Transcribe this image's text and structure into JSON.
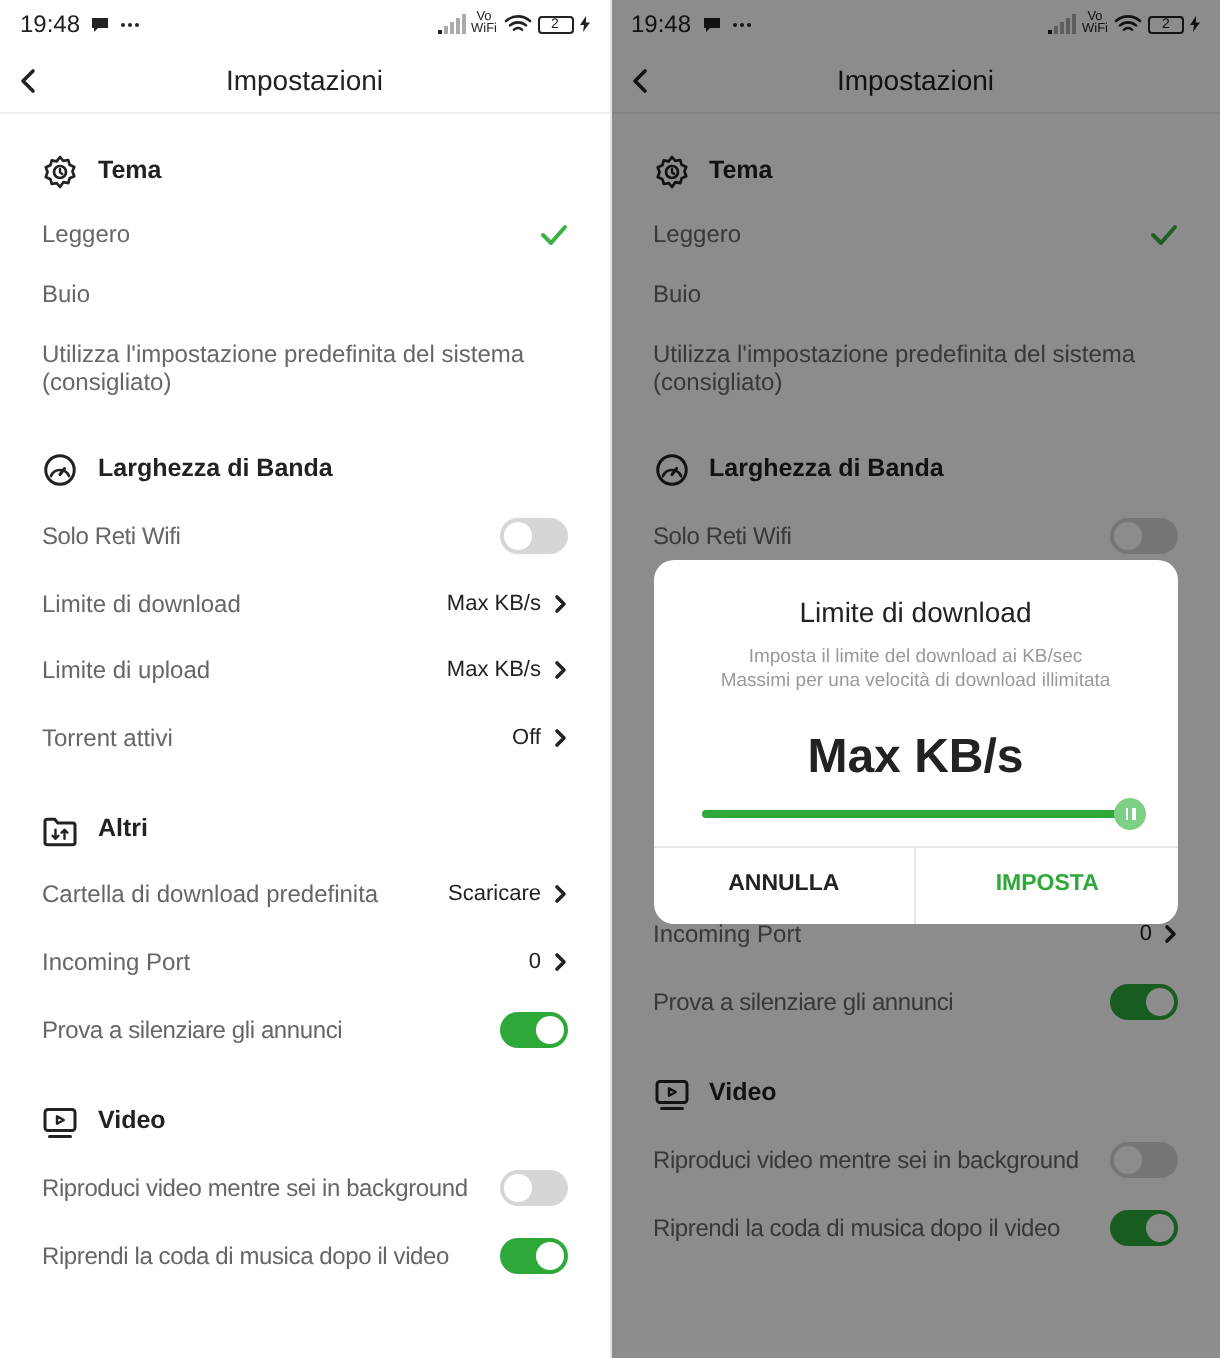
{
  "screens": [
    {
      "status_bar": {
        "time": "19:48",
        "network_top": "Vo",
        "network_bottom": "WiFi",
        "battery": "2"
      },
      "title": "Impostazioni",
      "items": [
        {
          "kind": "theme",
          "label": "Tema"
        },
        {
          "kind": "option",
          "label": "Leggero",
          "selected": true
        },
        {
          "kind": "option",
          "label": "Buio",
          "selected": false
        },
        {
          "kind": "option",
          "label": "Utilizza l'impostazione predefinita del sistema (consigliato)",
          "selected": false
        },
        {
          "kind": "bandwidth",
          "label": "Larghezza di Banda"
        },
        {
          "kind": "toggle",
          "label": "Solo Reti Wifi",
          "on": false
        },
        {
          "kind": "value",
          "label": "Limite di download",
          "value": "Max KB/s"
        },
        {
          "kind": "value",
          "label": "Limite di upload",
          "value": "Max KB/s"
        },
        {
          "kind": "value",
          "label": "Torrent attivi",
          "value": "Off"
        },
        {
          "kind": "others",
          "label": "Altri"
        },
        {
          "kind": "value",
          "label": "Cartella di download predefinita",
          "value": "Scaricare"
        },
        {
          "kind": "value",
          "label": "Incoming Port",
          "value": "0"
        },
        {
          "kind": "toggle",
          "label": "Prova a silenziare gli annunci",
          "on": true
        },
        {
          "kind": "video",
          "label": "Video"
        },
        {
          "kind": "toggle",
          "label": "Riproduci video mentre sei in background",
          "on": false
        },
        {
          "kind": "toggle",
          "label": "Riprendi la coda di musica dopo il video",
          "on": true
        }
      ]
    },
    {
      "status_bar": {
        "time": "19:48",
        "network_top": "Vo",
        "network_bottom": "WiFi",
        "battery": "2"
      },
      "title": "Impostazioni",
      "items": [
        {
          "kind": "theme",
          "label": "Tema"
        },
        {
          "kind": "option",
          "label": "Leggero",
          "selected": true
        },
        {
          "kind": "option",
          "label": "Buio",
          "selected": false
        },
        {
          "kind": "option",
          "label": "Utilizza l'impostazione predefinita del sistema (consigliato)",
          "selected": false
        },
        {
          "kind": "bandwidth",
          "label": "Larghezza di Banda"
        },
        {
          "kind": "toggle",
          "label": "Solo Reti Wifi",
          "on": false
        }
      ],
      "dialog": {
        "title": "Limite di download",
        "message": "Imposta il limite del download ai KB/sec Massimi per una velocità di download illimitata",
        "value": "Max KB/s",
        "level": 1,
        "buttons": [
          {
            "label": "ANNULLA",
            "primary": false
          },
          {
            "label": "IMPOSTA",
            "primary": true
          }
        ]
      },
      "items_below_dialog": [
        {
          "kind": "value",
          "label": "Incoming Port",
          "value": "0"
        },
        {
          "kind": "toggle",
          "label": "Prova a silenziare gli annunci",
          "on": true
        },
        {
          "kind": "video",
          "label": "Video"
        },
        {
          "kind": "toggle",
          "label": "Riproduci video mentre sei in background",
          "on": false
        },
        {
          "kind": "toggle",
          "label": "Riprendi la coda di musica dopo il video",
          "on": true
        }
      ]
    }
  ]
}
